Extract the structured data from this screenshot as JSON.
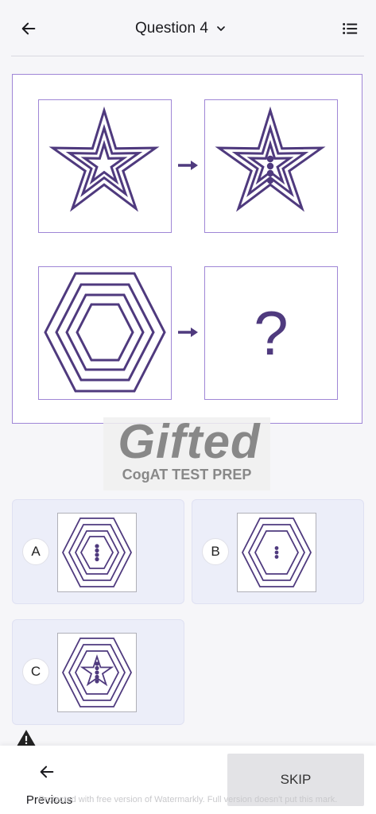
{
  "header": {
    "title": "Question 4",
    "back_icon": "arrow-left-icon",
    "dropdown_icon": "chevron-down-icon",
    "menu_icon": "list-menu-icon"
  },
  "question": {
    "placeholder_symbol": "?",
    "accent_color": "#4f3a7e",
    "border_color": "#9f86d6"
  },
  "watermark": {
    "logo": "Gifted",
    "subtitle": "CogAT TEST PREP"
  },
  "options": [
    {
      "letter": "A"
    },
    {
      "letter": "B"
    },
    {
      "letter": "C"
    }
  ],
  "footer": {
    "previous_label": "Previous",
    "skip_label": "SKIP",
    "watermark_note": "Protected with free version of Watermarkly. Full version doesn't put this mark."
  }
}
